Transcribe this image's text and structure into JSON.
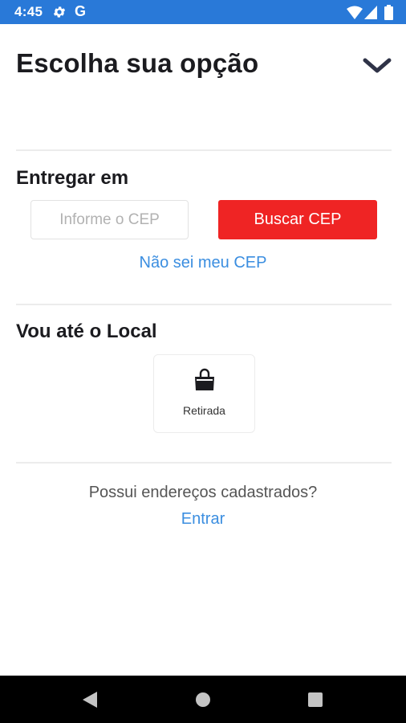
{
  "status_bar": {
    "time": "4:45",
    "g_label": "G",
    "icons": [
      "gear-icon",
      "google-icon",
      "wifi-icon",
      "signal-icon",
      "battery-icon"
    ],
    "background": "#2979d8"
  },
  "header": {
    "title": "Escolha sua opção",
    "collapse_icon": "chevron-down-icon"
  },
  "delivery": {
    "title": "Entregar em",
    "cep_placeholder": "Informe o CEP",
    "cep_value": "",
    "search_label": "Buscar CEP",
    "unknown_cep_link": "Não sei meu CEP"
  },
  "pickup": {
    "title": "Vou até o Local",
    "option_label": "Retirada",
    "option_icon": "shopping-bag-icon"
  },
  "account": {
    "question": "Possui endereços cadastrados?",
    "login_link": "Entrar"
  },
  "nav_bar": {
    "icons": [
      "back-icon",
      "home-icon",
      "recent-apps-icon"
    ]
  },
  "colors": {
    "accent": "#ef2424",
    "link": "#3b8ee0",
    "title": "#1b1b1f"
  }
}
